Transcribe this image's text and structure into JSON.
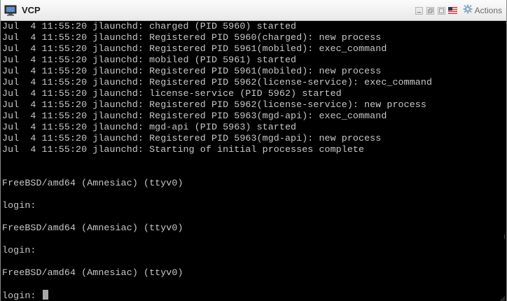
{
  "window": {
    "title": "VCP",
    "actions_label": "Actions"
  },
  "icons": {
    "app": "vmware-console-icon",
    "minimize": "minimize-icon",
    "restore": "restore-icon",
    "maximize": "maximize-icon",
    "keyboard_flag": "us-flag-icon",
    "actions": "gear-icon"
  },
  "colors": {
    "terminal_bg": "#000000",
    "terminal_fg": "#c8c8c8",
    "titlebar_bg": "#f2f2f2"
  },
  "console": {
    "lines": [
      "Jul  4 11:55:20 jlaunchd: charged (PID 5960) started",
      "Jul  4 11:55:20 jlaunchd: Registered PID 5960(charged): new process",
      "Jul  4 11:55:20 jlaunchd: Registered PID 5961(mobiled): exec_command",
      "Jul  4 11:55:20 jlaunchd: mobiled (PID 5961) started",
      "Jul  4 11:55:20 jlaunchd: Registered PID 5961(mobiled): new process",
      "Jul  4 11:55:20 jlaunchd: Registered PID 5962(license-service): exec_command",
      "Jul  4 11:55:20 jlaunchd: license-service (PID 5962) started",
      "Jul  4 11:55:20 jlaunchd: Registered PID 5962(license-service): new process",
      "Jul  4 11:55:20 jlaunchd: Registered PID 5963(mgd-api): exec_command",
      "Jul  4 11:55:20 jlaunchd: mgd-api (PID 5963) started",
      "Jul  4 11:55:20 jlaunchd: Registered PID 5963(mgd-api): new process",
      "Jul  4 11:55:20 jlaunchd: Starting of initial processes complete",
      "",
      "",
      "FreeBSD/amd64 (Amnesiac) (ttyv0)",
      "",
      "login:",
      "",
      "FreeBSD/amd64 (Amnesiac) (ttyv0)",
      "",
      "login:",
      "",
      "FreeBSD/amd64 (Amnesiac) (ttyv0)",
      "",
      "login: "
    ]
  }
}
